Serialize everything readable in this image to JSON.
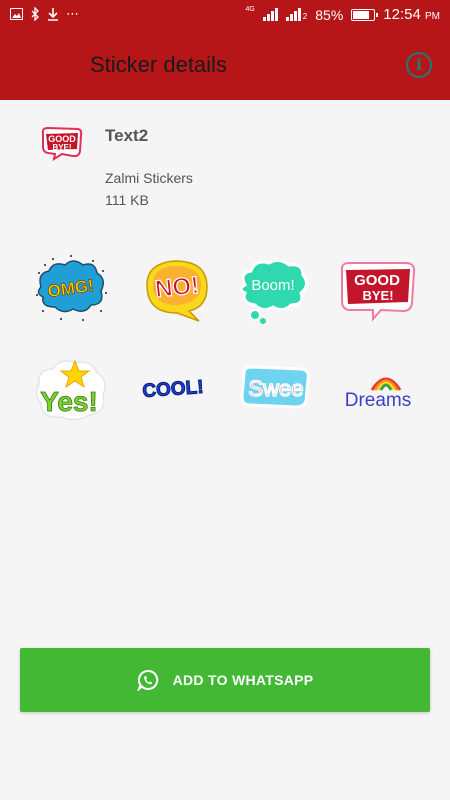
{
  "status_bar": {
    "battery": "85%",
    "battery_level": 0.85,
    "time": "12:54",
    "time_suffix": "PM",
    "network_label": "4G",
    "sim2_label": "2"
  },
  "app_bar": {
    "title": "Sticker details"
  },
  "pack": {
    "name": "Text2",
    "publisher": "Zalmi Stickers",
    "size": "111 KB"
  },
  "stickers": [
    {
      "name": "omg",
      "text": "OMG!"
    },
    {
      "name": "no",
      "text": "NO!"
    },
    {
      "name": "boom",
      "text": "Boom!"
    },
    {
      "name": "good-bye",
      "text": "GOOD BYE!"
    },
    {
      "name": "yes",
      "text": "Yes!"
    },
    {
      "name": "cool",
      "text": "COOL!"
    },
    {
      "name": "swee",
      "text": "Swee"
    },
    {
      "name": "dreams",
      "text": "Dreams"
    }
  ],
  "add_button": {
    "label": "ADD TO WHATSAPP"
  },
  "colors": {
    "app_bar": "#b71618",
    "info_icon": "#1f7a76",
    "add_button": "#42b835"
  }
}
